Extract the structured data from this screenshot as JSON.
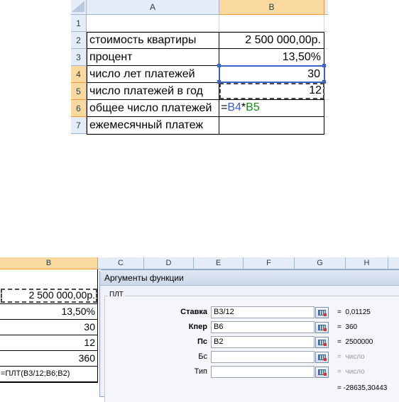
{
  "top_sheet": {
    "columns": [
      "A",
      "B"
    ],
    "rows": [
      {
        "num": "1",
        "a": "",
        "b": ""
      },
      {
        "num": "2",
        "a": "стоимость квартиры",
        "b": "2 500 000,00р."
      },
      {
        "num": "3",
        "a": "процент",
        "b": "13,50%"
      },
      {
        "num": "4",
        "a": "число лет платежей",
        "b": "30"
      },
      {
        "num": "5",
        "a": "число платежей в год",
        "b": "12"
      },
      {
        "num": "6",
        "a": "общее число платежей",
        "b": ""
      },
      {
        "num": "7",
        "a": "ежемесячный платеж",
        "b": ""
      }
    ],
    "formula": {
      "eq": "=",
      "ref1": "B4",
      "op": "*",
      "ref2": "B5"
    },
    "colors": {
      "ref1": "#3a5ad0",
      "ref2": "#1b8a1b",
      "header_selected": "#f9d99f"
    }
  },
  "bottom_sheet": {
    "columns": [
      "B",
      "C",
      "D",
      "E",
      "F",
      "G",
      "H"
    ],
    "cells": [
      "2 500 000,00р.",
      "13,50%",
      "30",
      "12",
      "360",
      "=ПЛТ(B3/12;B6;B2)"
    ],
    "dialog": {
      "title": "Аргументы функции",
      "function_name": "ПЛТ",
      "args": [
        {
          "label": "Ставка",
          "value": "B3/12",
          "result": "0,01125",
          "bold": true
        },
        {
          "label": "Кпер",
          "value": "B6",
          "result": "360",
          "bold": true
        },
        {
          "label": "Пс",
          "value": "B2",
          "result": "2500000",
          "bold": true
        },
        {
          "label": "Бс",
          "value": "",
          "result": "число",
          "bold": false
        },
        {
          "label": "Тип",
          "value": "",
          "result": "число",
          "bold": false
        }
      ],
      "eq": "=",
      "total": "= -28635,30443",
      "icon": "range-picker-icon"
    }
  }
}
